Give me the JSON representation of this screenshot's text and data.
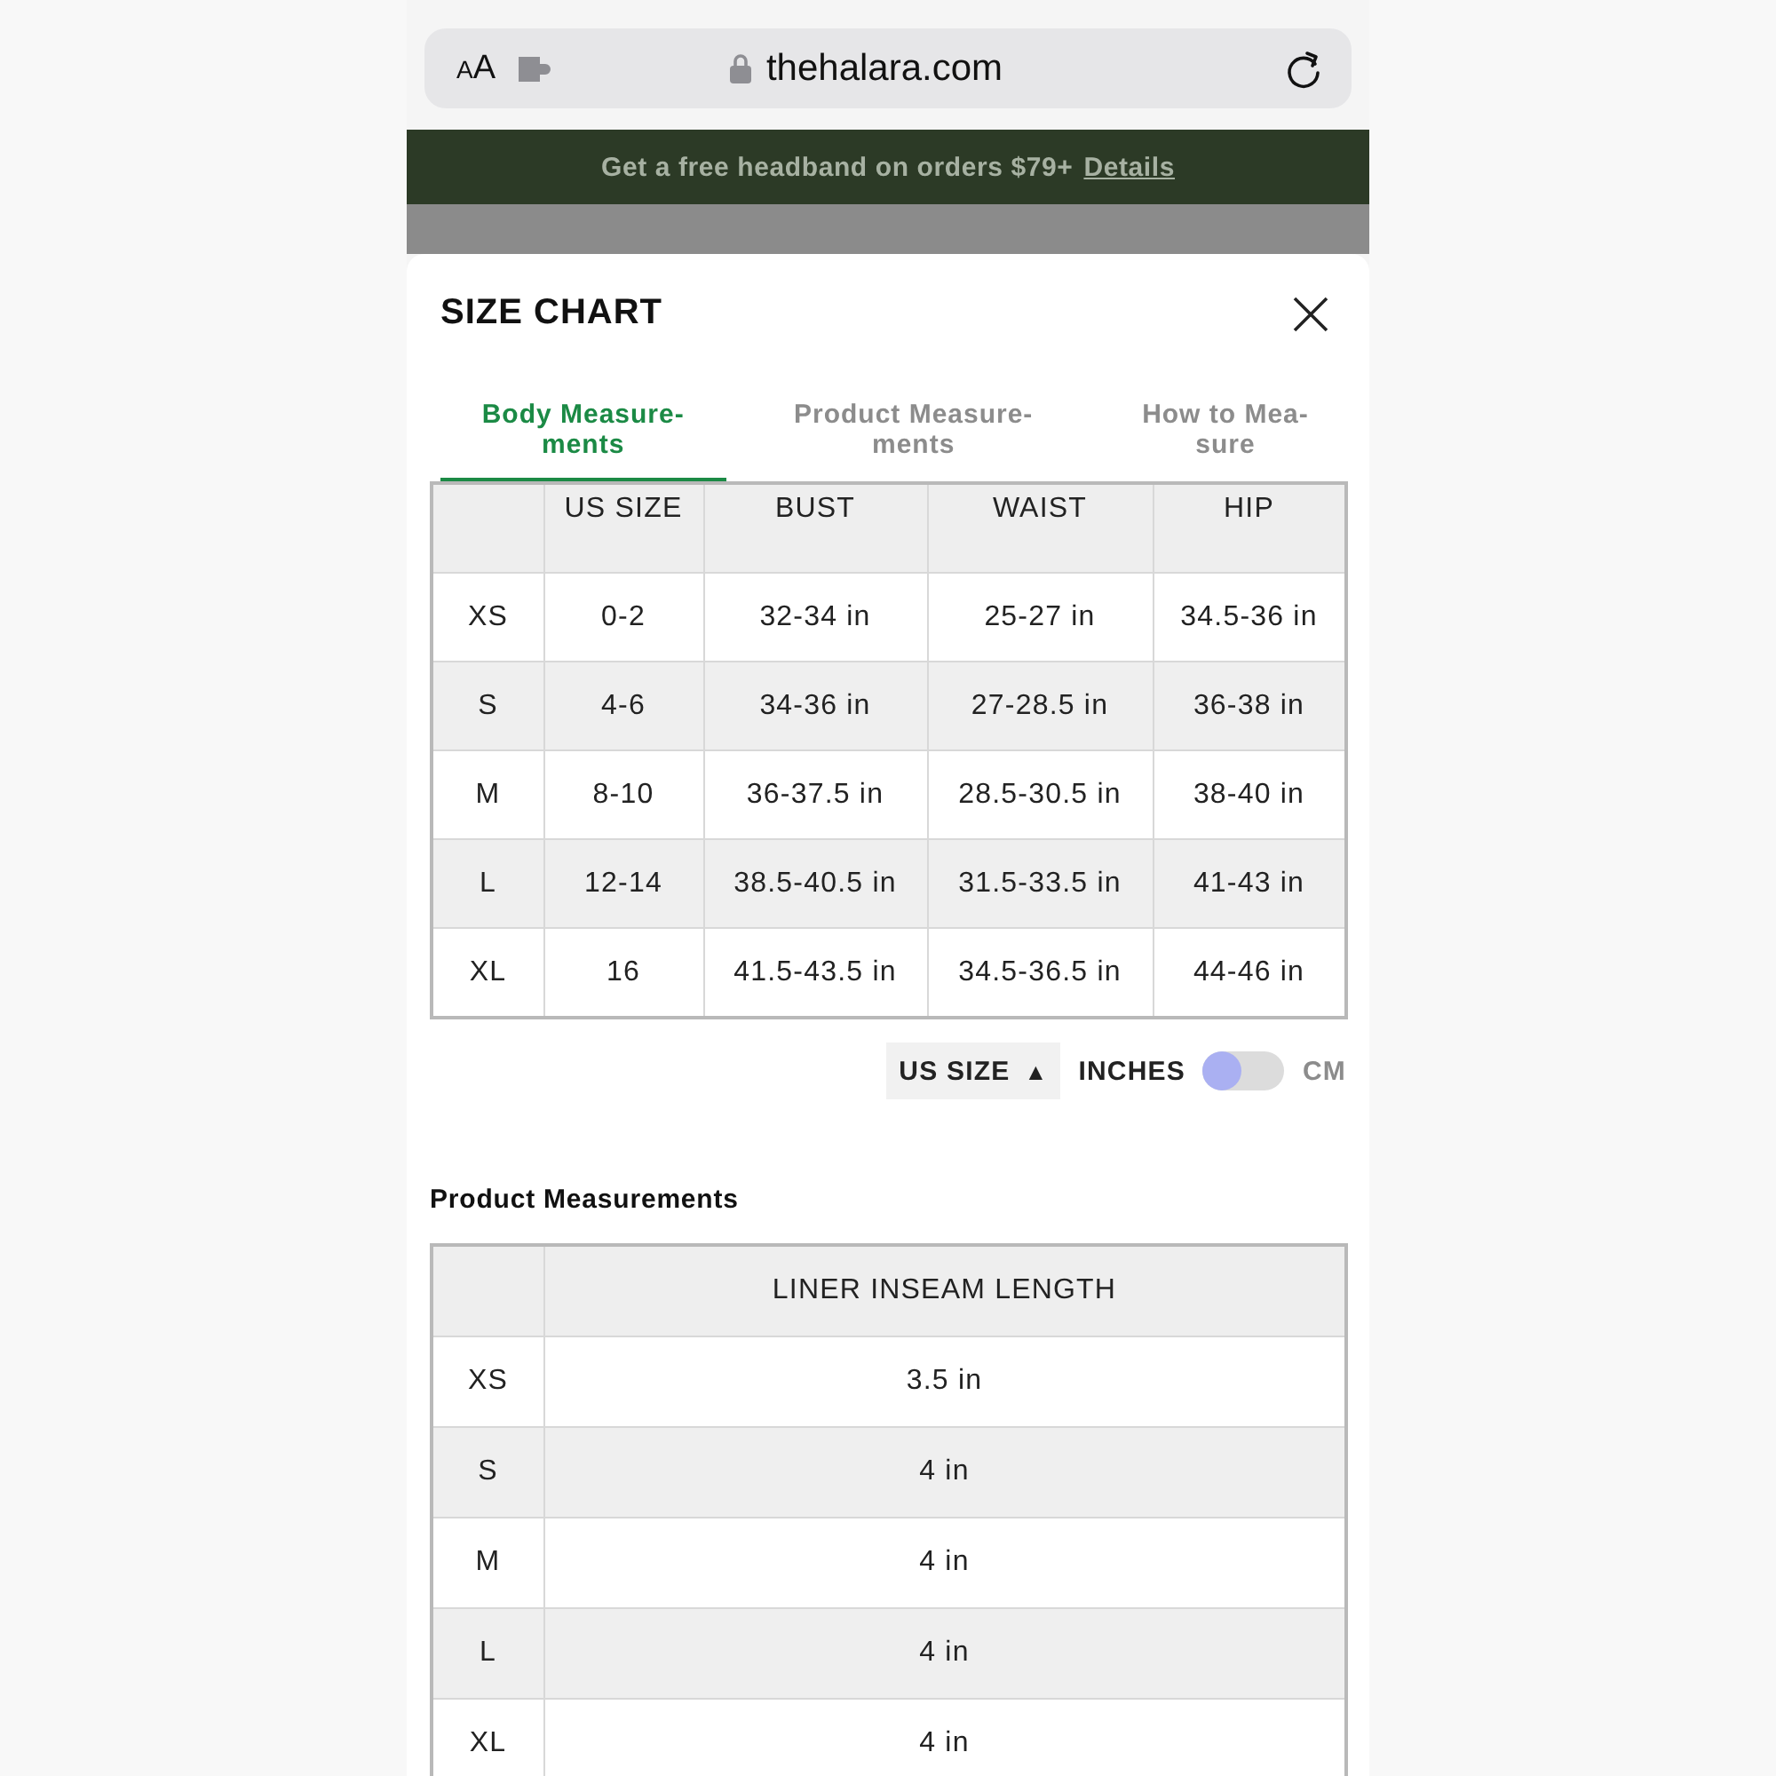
{
  "browser": {
    "text_size_button": "AA",
    "url": "thehalara.com"
  },
  "promo_banner": {
    "text": "Get a free headband on orders $79+",
    "link": "Details"
  },
  "modal": {
    "title": "SIZE CHART",
    "tabs": [
      {
        "label": "Body Measure-\nments",
        "selected": true
      },
      {
        "label": "Product Measure-\nments",
        "selected": false
      },
      {
        "label": "How to Mea-\nsure",
        "selected": false
      }
    ],
    "body_table": {
      "columns": [
        "",
        "US SIZE",
        "BUST",
        "WAIST",
        "HIP"
      ],
      "rows": [
        [
          "XS",
          "0-2",
          "32-34 in",
          "25-27 in",
          "34.5-36 in"
        ],
        [
          "S",
          "4-6",
          "34-36 in",
          "27-28.5 in",
          "36-38 in"
        ],
        [
          "M",
          "8-10",
          "36-37.5 in",
          "28.5-30.5 in",
          "38-40 in"
        ],
        [
          "L",
          "12-14",
          "38.5-40.5 in",
          "31.5-33.5 in",
          "41-43 in"
        ],
        [
          "XL",
          "16",
          "41.5-43.5 in",
          "34.5-36.5 in",
          "44-46 in"
        ]
      ]
    },
    "sort_button": {
      "label": "US SIZE",
      "arrow": "▲"
    },
    "unit_toggle": {
      "left_label": "INCHES",
      "right_label": "CM",
      "on": false
    },
    "product_section": {
      "title": "Product Measurements",
      "table": {
        "columns": [
          "",
          "LINER INSEAM LENGTH"
        ],
        "rows": [
          [
            "XS",
            "3.5 in"
          ],
          [
            "S",
            "4 in"
          ],
          [
            "M",
            "4 in"
          ],
          [
            "L",
            "4 in"
          ],
          [
            "XL",
            "4 in"
          ]
        ]
      }
    }
  }
}
